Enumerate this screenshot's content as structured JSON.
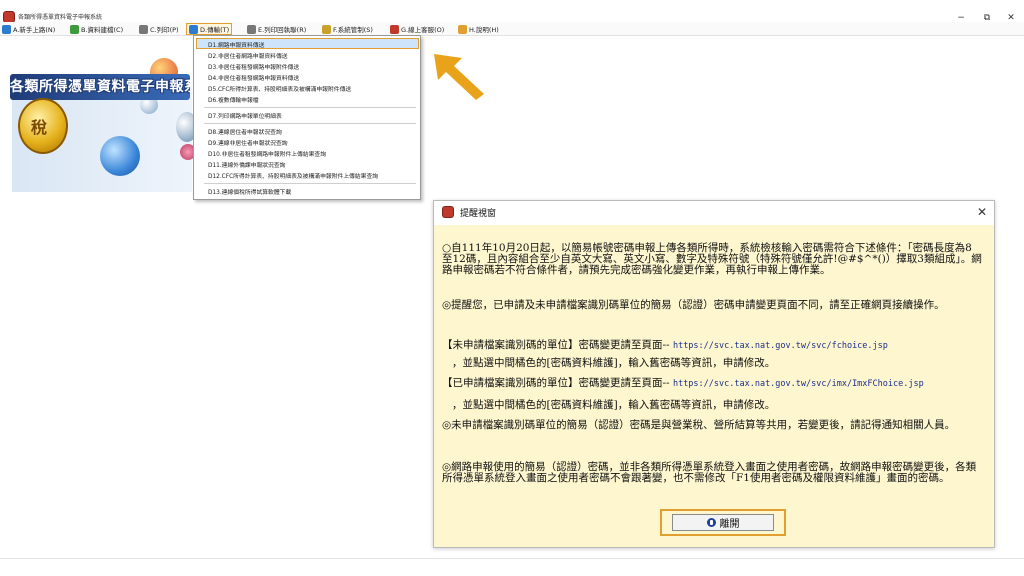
{
  "window": {
    "title": "各類所得憑單資料電子申報系統",
    "minimize": "−",
    "maximize": "⧉",
    "close": "✕"
  },
  "menubar": {
    "items": [
      {
        "label": "A.新手上路(N)",
        "icon": "compass-icon",
        "color": "#2b7bd1"
      },
      {
        "label": "B.資料建檔(C)",
        "icon": "edit-icon",
        "color": "#3d9b3d"
      },
      {
        "label": "C.列印(P)",
        "icon": "printer-icon",
        "color": "#777777"
      },
      {
        "label": "D.傳輸(T)",
        "icon": "transfer-icon",
        "color": "#2b7bd1"
      },
      {
        "label": "E.列印回執聯(R)",
        "icon": "receipt-icon",
        "color": "#777777"
      },
      {
        "label": "F.系統管制(S)",
        "icon": "gear-icon",
        "color": "#caa12b"
      },
      {
        "label": "G.線上客服(O)",
        "icon": "person-icon",
        "color": "#c0392b"
      },
      {
        "label": "H.說明(H)",
        "icon": "help-icon",
        "color": "#e0a030"
      }
    ]
  },
  "dropdown": {
    "items": [
      "D1.網路申報資料傳送",
      "D2.非居住者網路申報資料傳送",
      "D3.非居住者租發網路申報附件傳送",
      "D4.非居住者租發網路申報資料傳送",
      "D5.CFC所得計算表、持股明細表及被構滿申報附件傳送",
      "D6.複數傳輸申報檔",
      "D7.列印網路申報單位明細表",
      "D8.連線居住者申報狀況查詢",
      "D9.連線非居住者申報狀況查詢",
      "D10.非居住者租發網路申報附件上傳結果查詢",
      "D11.連線外僑課申報狀況查詢",
      "D12.CFC所得計算表、持股明細表及被構滿申報附件上傳結果查詢",
      "D13.連線個稅所得試算軟體下載"
    ]
  },
  "banner": {
    "title": "各類所得憑單資料電子申報系",
    "coin_char": "稅"
  },
  "dialog": {
    "title": "提醒視窗",
    "close": "✕",
    "para1": "○自111年10月20日起，以簡易帳號密碼申報上傳各類所得時，系統檢核輸入密碼需符合下述條件：「密碼長度為8至12碼，且內容組合至少自英文大寫、英文小寫、數字及特殊符號（特殊符號僅允許!@#$^*()）擇取3類組成」。網路申報密碼若不符合條件者，請預先完成密碼強化變更作業，再執行申報上傳作業。",
    "para2": "◎提醒您，已申請及未申請檔案識別碼單位的簡易（認證）密碼申請變更頁面不同，請至正確網頁接續操作。",
    "line3_label": "【未申請檔案識別碼的單位】密碼變更請至頁面--",
    "line3_url": "https://svc.tax.nat.gov.tw/svc/fchoice.jsp",
    "line4": "，並點選中間橘色的[密碼資料維護]，輸入舊密碼等資訊，申請修改。",
    "line5_label": "【已申請檔案識別碼的單位】密碼變更請至頁面--",
    "line5_url": "https://svc.tax.nat.gov.tw/svc/imx/ImxFChoice.jsp",
    "line6": "，並點選中間橘色的[密碼資料維護]，輸入舊密碼等資訊，申請修改。",
    "para7": "◎未申請檔案識別碼單位的簡易（認證）密碼是與營業稅、營所結算等共用，若變更後，請記得通知相關人員。",
    "para8": "◎網路申報使用的簡易（認證）密碼，並非各類所得憑單系統登入畫面之使用者密碼，故網路申報密碼變更後，各類所得憑單系統登入畫面之使用者密碼不會跟著變，也不需修改「F1使用者密碼及權限資料維護」畫面的密碼。",
    "exit_label": "離開"
  }
}
